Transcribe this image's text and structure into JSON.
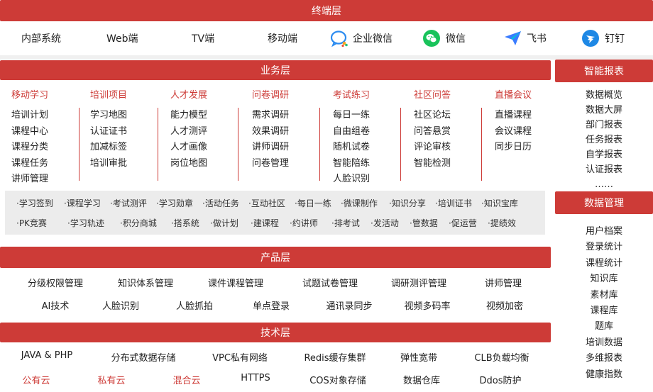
{
  "terminal": {
    "title": "终端层",
    "items": [
      {
        "label": "内部系统",
        "icon": ""
      },
      {
        "label": "Web端",
        "icon": ""
      },
      {
        "label": "TV端",
        "icon": ""
      },
      {
        "label": "移动端",
        "icon": ""
      },
      {
        "label": "企业微信",
        "icon": "wecom-icon"
      },
      {
        "label": "微信",
        "icon": "wechat-icon"
      },
      {
        "label": "飞书",
        "icon": "feishu-icon"
      },
      {
        "label": "钉钉",
        "icon": "dingtalk-icon"
      }
    ]
  },
  "business": {
    "title": "业务层",
    "columns": [
      {
        "head": "移动学习",
        "items": [
          "培训计划",
          "课程中心",
          "课程分类",
          "课程任务",
          "讲师管理"
        ]
      },
      {
        "head": "培训项目",
        "items": [
          "学习地图",
          "认证证书",
          "加减标签",
          "培训审批"
        ]
      },
      {
        "head": "人才发展",
        "items": [
          "能力模型",
          "人才测评",
          "人才画像",
          "岗位地图"
        ]
      },
      {
        "head": "问卷调研",
        "items": [
          "需求调研",
          "效果调研",
          "讲师调研",
          "问卷管理"
        ]
      },
      {
        "head": "考试练习",
        "items": [
          "每日一练",
          "自由组卷",
          "随机试卷",
          "智能陪练",
          "人脸识别"
        ]
      },
      {
        "head": "社区问答",
        "items": [
          "社区论坛",
          "问答悬赏",
          "评论审核",
          "智能检测"
        ]
      },
      {
        "head": "直播会议",
        "items": [
          "直播课程",
          "会议课程",
          "同步日历"
        ]
      }
    ],
    "tags_row1": [
      "·学习签到",
      "·课程学习",
      "·考试测评",
      "·学习勋章",
      "·活动任务",
      "·互动社区",
      "·每日一练",
      "·微课制作",
      "·知识分享",
      "·培训证书",
      "·知识宝库"
    ],
    "tags_row2": [
      "·PK竞赛",
      "·学习轨迹",
      "·积分商城",
      "·搭系统",
      "·做计划",
      "·建课程",
      "·约讲师",
      "·排考试",
      "·发活动",
      "·管数据",
      "·促运营",
      "·提绩效"
    ]
  },
  "product": {
    "title": "产品层",
    "row1": [
      "分级权限管理",
      "知识体系管理",
      "课件课程管理",
      "试题试卷管理",
      "调研测评管理",
      "讲师管理"
    ],
    "row2": [
      "AI技术",
      "人脸识别",
      "人脸抓拍",
      "单点登录",
      "通讯录同步",
      "视频多码率",
      "视频加密"
    ]
  },
  "tech": {
    "title": "技术层",
    "row1": [
      "JAVA & PHP",
      "分布式数据存储",
      "VPC私有网络",
      "Redis缓存集群",
      "弹性宽带",
      "CLB负载均衡"
    ],
    "row2": [
      "公有云",
      "私有云",
      "混合云",
      "HTTPS",
      "COS对象存储",
      "数据仓库",
      "Ddos防护"
    ],
    "red_color": "#cd3b37"
  },
  "smart_report": {
    "title": "智能报表",
    "items": [
      "数据概览",
      "数据大屏",
      "部门报表",
      "任务报表",
      "自学报表",
      "认证报表",
      "……"
    ]
  },
  "data_management": {
    "title": "数据管理",
    "items": [
      "用户档案",
      "登录统计",
      "课程统计",
      "知识库",
      "素材库",
      "课程库",
      "题库",
      "培训数据",
      "多维报表",
      "健康指数"
    ]
  },
  "colors": {
    "accent": "#cd3b37",
    "panel": "#ececec"
  }
}
